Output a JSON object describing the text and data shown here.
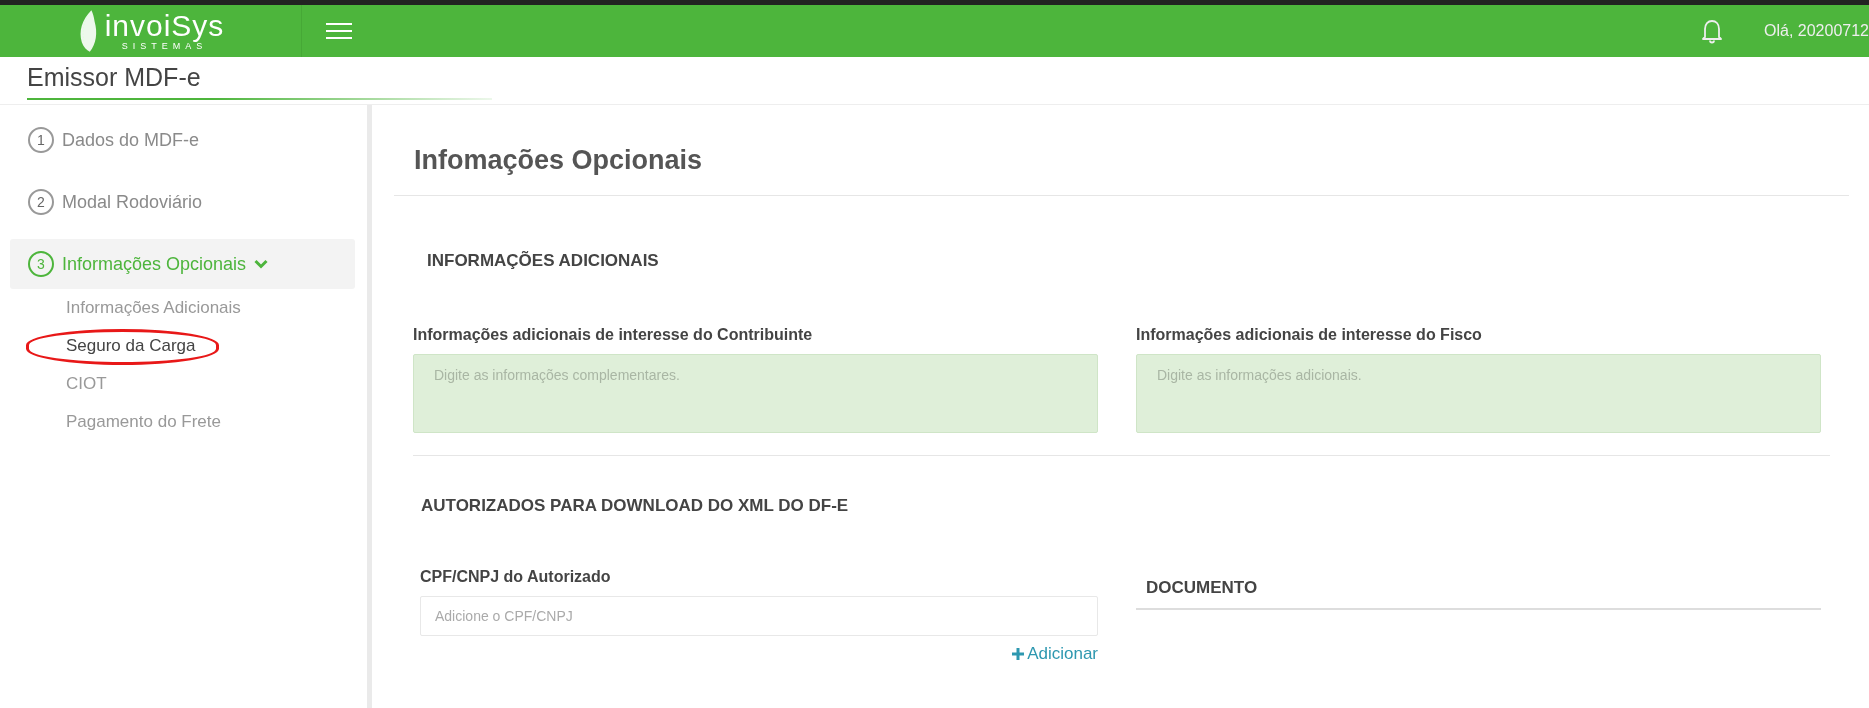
{
  "header": {
    "logo_text": "invoiSys",
    "logo_subtext": "SISTEMAS",
    "greeting": "Olá, 20200712"
  },
  "page_title": "Emissor MDF-e",
  "steps": [
    {
      "number": "1",
      "label": "Dados do MDF-e",
      "selected": false
    },
    {
      "number": "2",
      "label": "Modal Rodoviário",
      "selected": false
    },
    {
      "number": "3",
      "label": "Informações Opcionais",
      "selected": true,
      "expanded": true,
      "children": [
        {
          "label": "Informações Adicionais",
          "selected": false
        },
        {
          "label": "Seguro da Carga",
          "selected": true
        },
        {
          "label": "CIOT",
          "selected": false
        },
        {
          "label": "Pagamento do Frete",
          "selected": false
        }
      ]
    }
  ],
  "main": {
    "title": "Infomações Opcionais",
    "sections": [
      {
        "kind": "textareas",
        "heading": "INFORMAÇÕES ADICIONAIS",
        "fields": [
          {
            "label": "Informações adicionais de interesse do Contribuinte",
            "placeholder": "Digite as informações complementares."
          },
          {
            "label": "Informações adicionais de interesse do Fisco",
            "placeholder": "Digite as informações adicionais."
          }
        ]
      },
      {
        "kind": "authorized",
        "heading": "AUTORIZADOS PARA DOWNLOAD DO XML DO DF-E",
        "field": {
          "label": "CPF/CNPJ do Autorizado",
          "placeholder": "Adicione o CPF/CNPJ"
        },
        "add_button": "Adicionar",
        "table_heading": "DOCUMENTO"
      }
    ]
  }
}
